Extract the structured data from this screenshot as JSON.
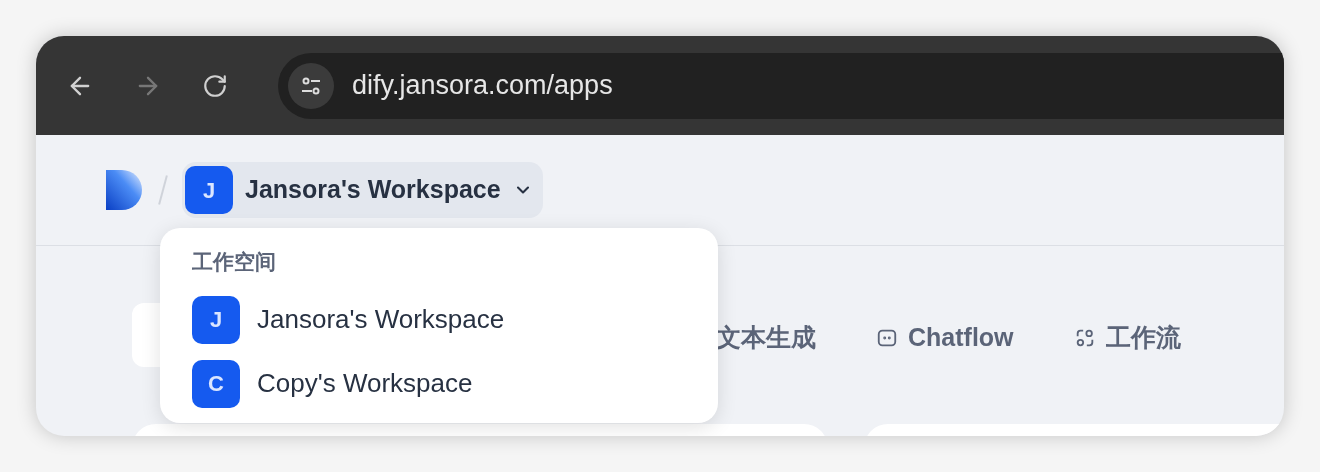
{
  "browser": {
    "url": "dify.jansora.com/apps",
    "forward_disabled": true
  },
  "header": {
    "workspace": {
      "initial": "J",
      "name": "Jansora's Workspace",
      "expanded": true
    }
  },
  "workspace_menu": {
    "heading": "工作空间",
    "items": [
      {
        "initial": "J",
        "name": "Jansora's Workspace"
      },
      {
        "initial": "C",
        "name": "Copy's Workspace"
      }
    ]
  },
  "app_tabs": [
    {
      "kind": "text",
      "label": "文本生成"
    },
    {
      "kind": "chatflow",
      "label": "Chatflow"
    },
    {
      "kind": "workflow",
      "label": "工作流"
    }
  ]
}
